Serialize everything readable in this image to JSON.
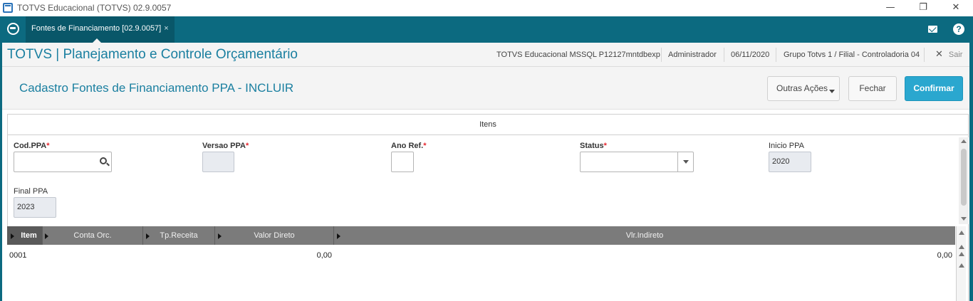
{
  "window": {
    "title": "TOTVS Educacional (TOTVS) 02.9.0057"
  },
  "nav": {
    "tab_label": "Fontes de Financiamento [02.9.0057]",
    "tab_close": "×"
  },
  "app": {
    "title": "TOTVS | Planejamento e Controle Orçamentário",
    "environment": "TOTVS Educacional MSSQL P12127mntdbexp",
    "user": "Administrador",
    "date": "06/11/2020",
    "branch": "Grupo Totvs 1 / Filial - Controladoria 04",
    "logout": "Sair"
  },
  "page": {
    "title": "Cadastro Fontes de Financiamento PPA - INCLUIR",
    "buttons": {
      "other_actions": "Outras Ações",
      "close": "Fechar",
      "confirm": "Confirmar"
    }
  },
  "form": {
    "section_title": "Itens",
    "fields": {
      "cod_ppa": {
        "label": "Cod.PPA",
        "value": ""
      },
      "versao_ppa": {
        "label": "Versao PPA",
        "value": ""
      },
      "ano_ref": {
        "label": "Ano Ref.",
        "value": ""
      },
      "status": {
        "label": "Status",
        "value": ""
      },
      "inicio_ppa": {
        "label": "Inicio PPA",
        "value": "2020"
      },
      "final_ppa": {
        "label": "Final PPA",
        "value": "2023"
      }
    },
    "required_mark": "*"
  },
  "grid": {
    "columns": [
      "Item",
      "Conta Orc.",
      "Tp.Receita",
      "Valor Direto",
      "Vlr.Indireto"
    ],
    "rows": [
      {
        "item": "0001",
        "conta_orc": "",
        "tp_receita": "",
        "valor_direto": "0,00",
        "vlr_indireto": "0,00"
      }
    ]
  },
  "colors": {
    "nav": "#0c6a80",
    "accent_text": "#1a7fa0",
    "primary_button": "#2aa7cf",
    "required": "#e5262e"
  }
}
